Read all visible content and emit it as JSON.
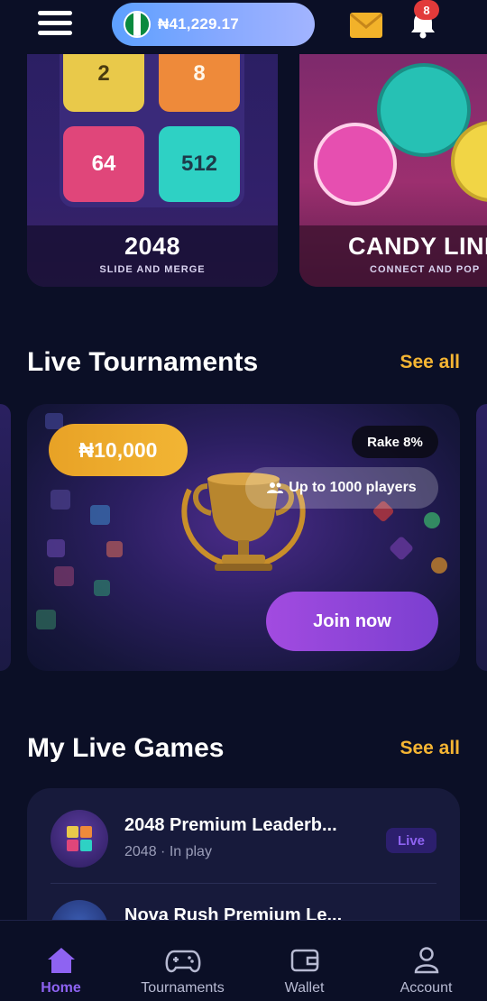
{
  "header": {
    "balance": "₦41,229.17",
    "notification_count": "8",
    "colors": {
      "pill": "#7fa8ff",
      "mail": "#f2b22a",
      "badge": "#e23a3a"
    },
    "icons": [
      "menu-icon",
      "nigeria-flag-icon",
      "mail-icon",
      "bell-icon"
    ]
  },
  "games": [
    {
      "title": "2048",
      "subtitle": "SLIDE AND MERGE",
      "tiles": [
        "2",
        "8",
        "64",
        "512"
      ]
    },
    {
      "title": "CANDY LINE",
      "subtitle": "CONNECT AND POP"
    }
  ],
  "tournaments": {
    "heading": "Live Tournaments",
    "see_all": "See all",
    "card": {
      "prize": "₦10,000",
      "rake": "Rake 8%",
      "players": "Up to 1000 players",
      "join": "Join now"
    }
  },
  "live_games": {
    "heading": "My Live Games",
    "see_all": "See all",
    "items": [
      {
        "title": "2048 Premium Leaderb...",
        "subtitle": "2048 · In play",
        "status": "Live"
      },
      {
        "title": "Nova Rush Premium Le..."
      }
    ]
  },
  "nav": {
    "items": [
      {
        "label": "Home",
        "icon": "home-icon",
        "active": true
      },
      {
        "label": "Tournaments",
        "icon": "gamepad-icon",
        "active": false
      },
      {
        "label": "Wallet",
        "icon": "wallet-icon",
        "active": false
      },
      {
        "label": "Account",
        "icon": "user-icon",
        "active": false
      }
    ],
    "accent": "#8e63f2"
  }
}
